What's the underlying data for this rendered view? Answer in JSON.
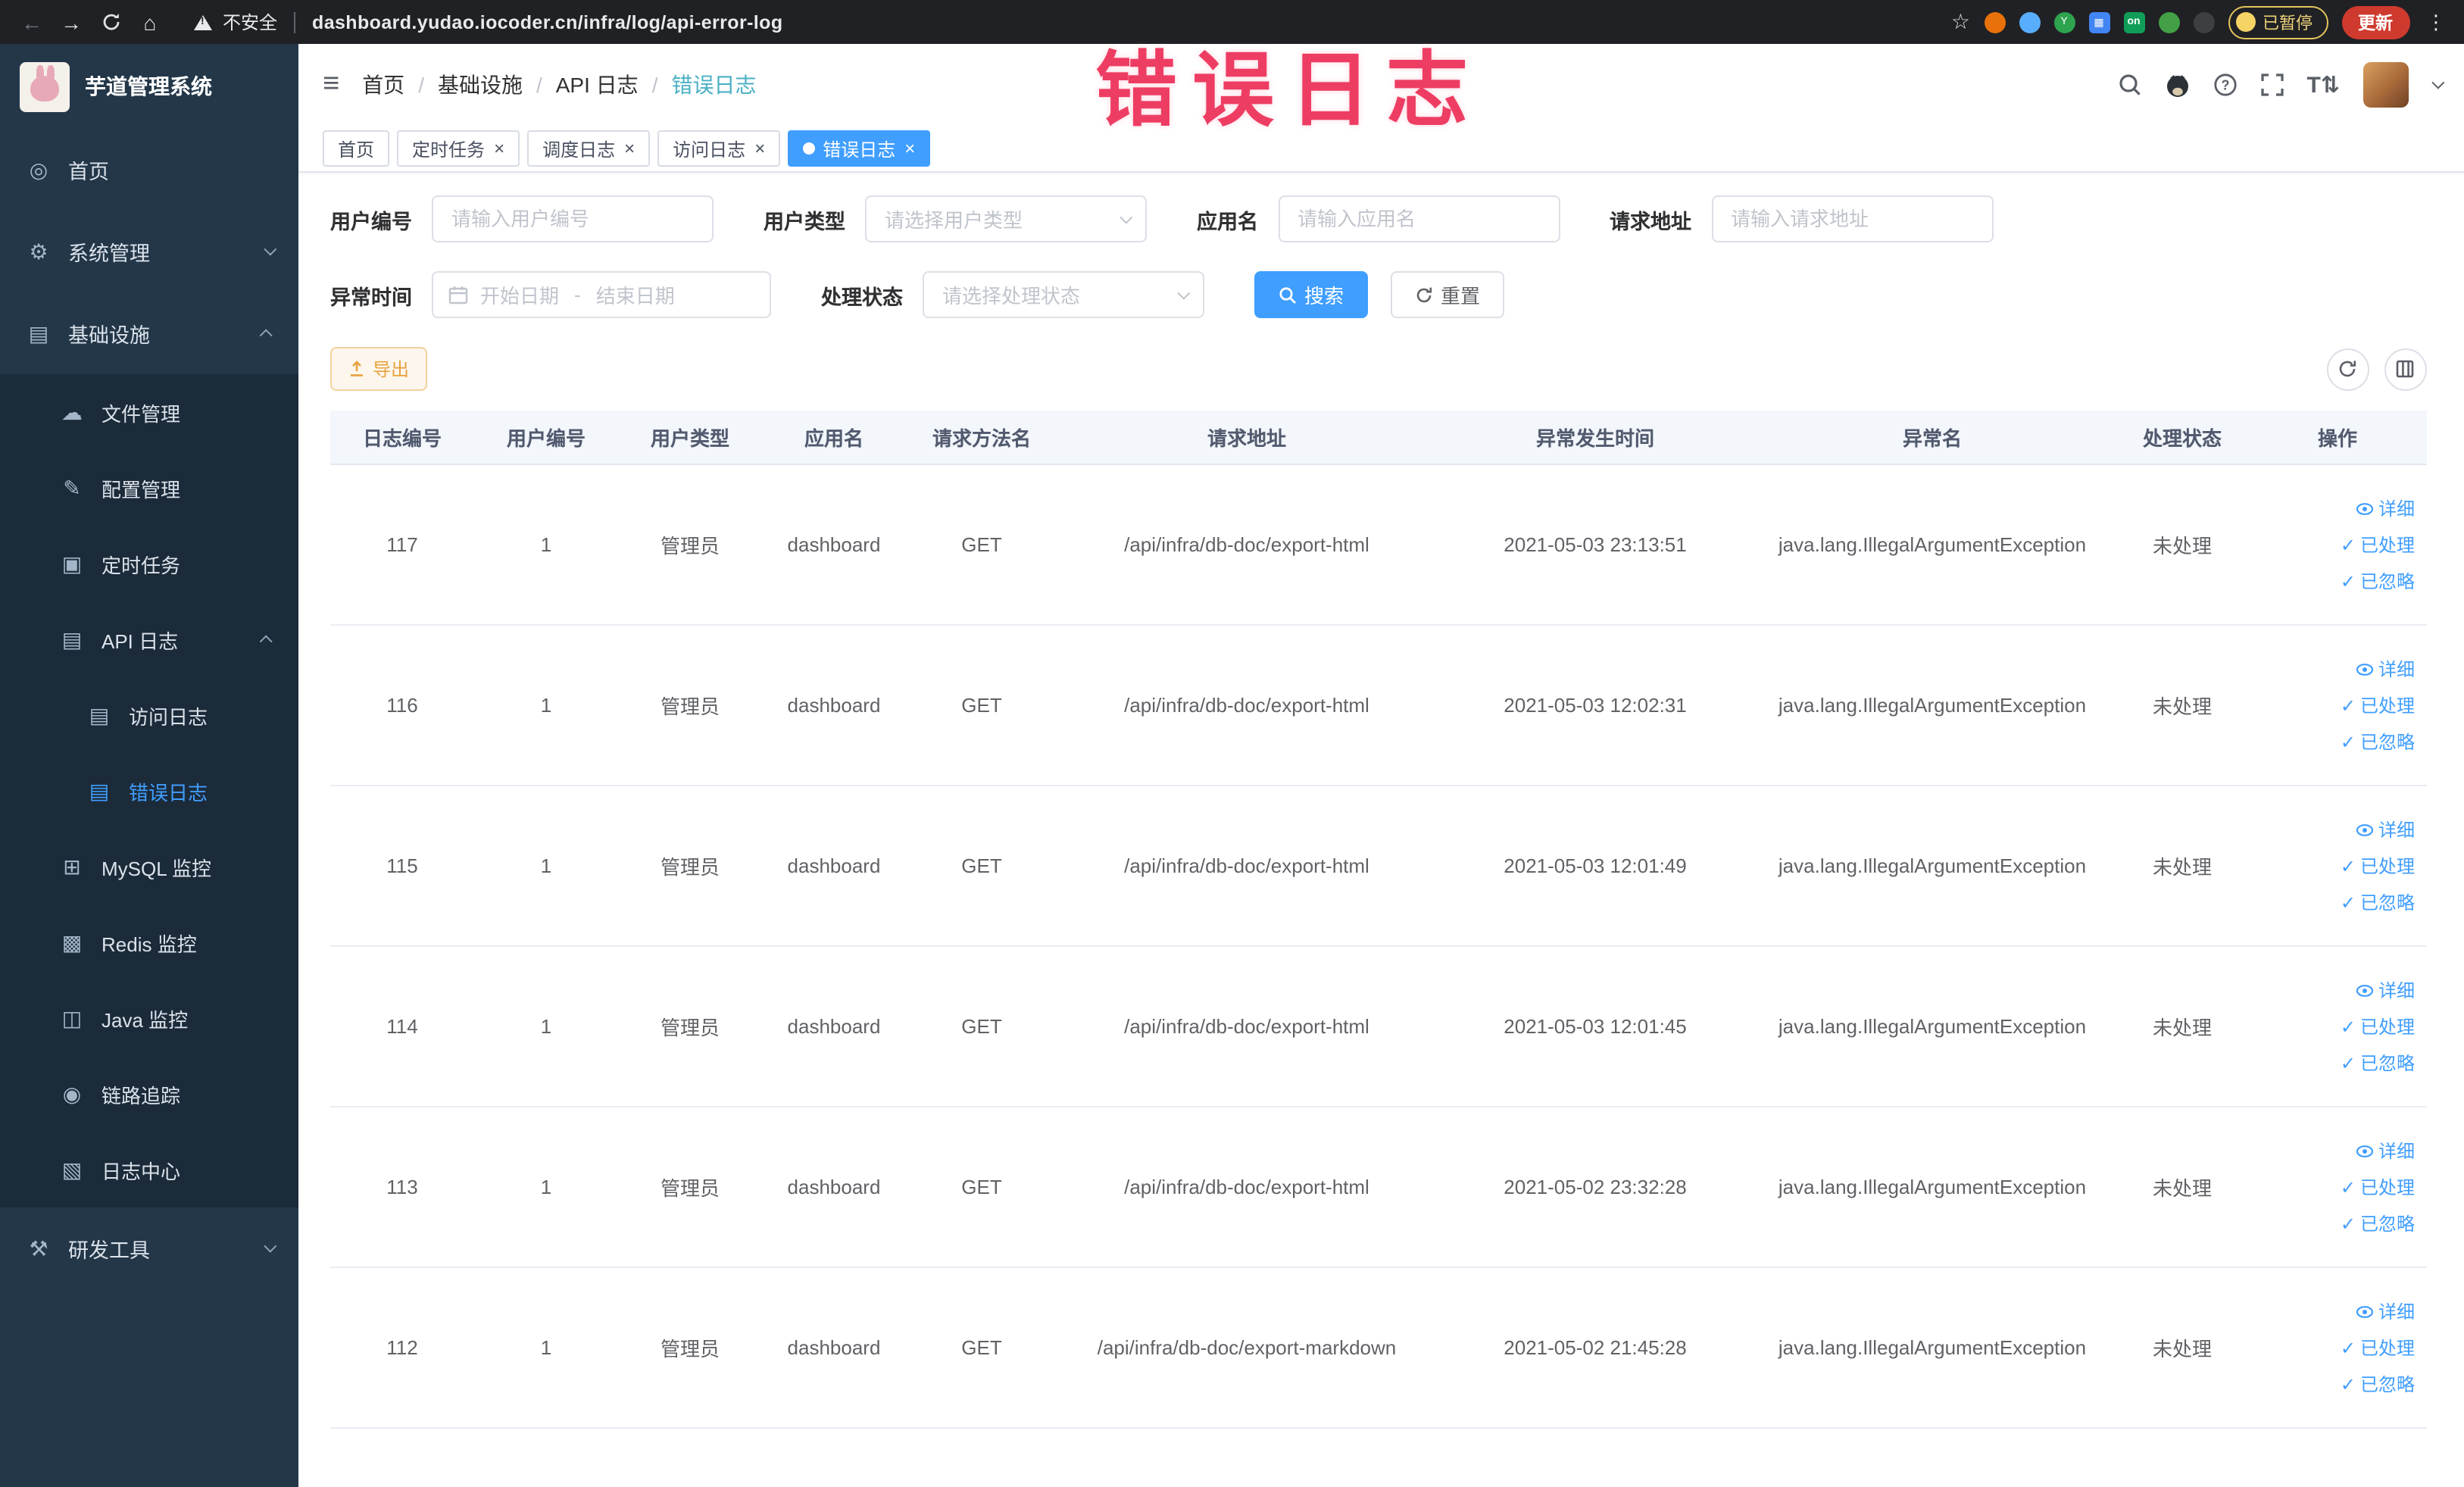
{
  "browser": {
    "security_label": "不安全",
    "url": "dashboard.yudao.iocoder.cn/infra/log/api-error-log",
    "extension_on_label": "on",
    "paused_badge": "已暂停",
    "update_label": "更新"
  },
  "watermark_text": "错误日志",
  "sidebar": {
    "logo_title": "芋道管理系统",
    "home": "首页",
    "system_mgmt": "系统管理",
    "infrastructure": "基础设施",
    "file_mgmt": "文件管理",
    "config_mgmt": "配置管理",
    "scheduled_jobs": "定时任务",
    "api_logs": "API 日志",
    "access_log": "访问日志",
    "error_log": "错误日志",
    "mysql_monitor": "MySQL 监控",
    "redis_monitor": "Redis 监控",
    "java_monitor": "Java 监控",
    "trace": "链路追踪",
    "log_center": "日志中心",
    "dev_tools": "研发工具"
  },
  "breadcrumb": [
    "首页",
    "基础设施",
    "API 日志",
    "错误日志"
  ],
  "tabs": [
    {
      "label": "首页",
      "closable": false,
      "active": false
    },
    {
      "label": "定时任务",
      "closable": true,
      "active": false
    },
    {
      "label": "调度日志",
      "closable": true,
      "active": false
    },
    {
      "label": "访问日志",
      "closable": true,
      "active": false
    },
    {
      "label": "错误日志",
      "closable": true,
      "active": true
    }
  ],
  "filters": {
    "user_id_label": "用户编号",
    "user_id_placeholder": "请输入用户编号",
    "user_type_label": "用户类型",
    "user_type_placeholder": "请选择用户类型",
    "app_name_label": "应用名",
    "app_name_placeholder": "请输入应用名",
    "request_url_label": "请求地址",
    "request_url_placeholder": "请输入请求地址",
    "exception_time_label": "异常时间",
    "start_date_placeholder": "开始日期",
    "date_separator": "-",
    "end_date_placeholder": "结束日期",
    "status_label": "处理状态",
    "status_placeholder": "请选择处理状态",
    "search_button": "搜索",
    "reset_button": "重置"
  },
  "toolbar": {
    "export_button": "导出"
  },
  "table": {
    "columns": [
      "日志编号",
      "用户编号",
      "用户类型",
      "应用名",
      "请求方法名",
      "请求地址",
      "异常发生时间",
      "异常名",
      "处理状态",
      "操作"
    ],
    "action_labels": {
      "detail": "详细",
      "processed": "已处理",
      "ignored": "已忽略"
    },
    "rows": [
      {
        "log_id": "117",
        "user_id": "1",
        "user_type": "管理员",
        "app_name": "dashboard",
        "method": "GET",
        "request_url": "/api/infra/db-doc/export-html",
        "time": "2021-05-03 23:13:51",
        "exception": "java.lang.IllegalArgumentException",
        "status": "未处理"
      },
      {
        "log_id": "116",
        "user_id": "1",
        "user_type": "管理员",
        "app_name": "dashboard",
        "method": "GET",
        "request_url": "/api/infra/db-doc/export-html",
        "time": "2021-05-03 12:02:31",
        "exception": "java.lang.IllegalArgumentException",
        "status": "未处理"
      },
      {
        "log_id": "115",
        "user_id": "1",
        "user_type": "管理员",
        "app_name": "dashboard",
        "method": "GET",
        "request_url": "/api/infra/db-doc/export-html",
        "time": "2021-05-03 12:01:49",
        "exception": "java.lang.IllegalArgumentException",
        "status": "未处理"
      },
      {
        "log_id": "114",
        "user_id": "1",
        "user_type": "管理员",
        "app_name": "dashboard",
        "method": "GET",
        "request_url": "/api/infra/db-doc/export-html",
        "time": "2021-05-03 12:01:45",
        "exception": "java.lang.IllegalArgumentException",
        "status": "未处理"
      },
      {
        "log_id": "113",
        "user_id": "1",
        "user_type": "管理员",
        "app_name": "dashboard",
        "method": "GET",
        "request_url": "/api/infra/db-doc/export-html",
        "time": "2021-05-02 23:32:28",
        "exception": "java.lang.IllegalArgumentException",
        "status": "未处理"
      },
      {
        "log_id": "112",
        "user_id": "1",
        "user_type": "管理员",
        "app_name": "dashboard",
        "method": "GET",
        "request_url": "/api/infra/db-doc/export-markdown",
        "time": "2021-05-02 21:45:28",
        "exception": "java.lang.IllegalArgumentException",
        "status": "未处理"
      }
    ]
  },
  "colors": {
    "accent_blue": "#409eff",
    "warning_orange": "#e6a23c",
    "watermark_red": "#ee3d63",
    "sidebar_bg": "#233749",
    "sidebar_submenu_bg": "#1c2b3a",
    "update_button_red": "#cf3a2e"
  }
}
